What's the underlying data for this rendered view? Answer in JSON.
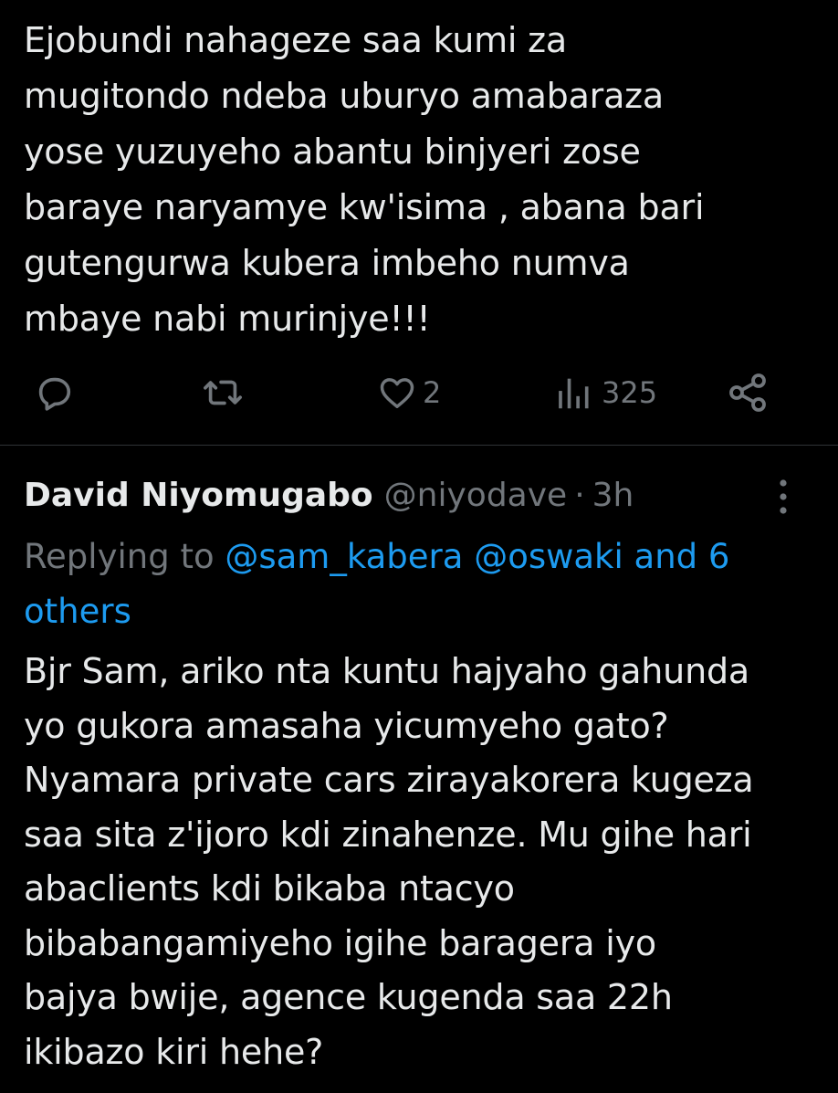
{
  "top_tweet": {
    "text_lines": [
      "Ejobundi nahageze saa kumi za",
      "mugitondo ndeba uburyo amabaraza",
      "yose yuzuyeho abantu binjyeri zose",
      "baraye naryamye kw'isima , abana bari",
      "gutengurwa kubera imbeho numva",
      "mbaye nabi murinjye!!!"
    ],
    "actions": {
      "reply_icon": "speech-bubble-icon",
      "retweet_icon": "retweet-icon",
      "like_icon": "heart-icon",
      "like_count": "2",
      "views_icon": "bar-chart-icon",
      "views_count": "325",
      "share_icon": "share-icon"
    }
  },
  "reply": {
    "author_name": "David Niyomugabo",
    "handle": "@niyodave",
    "separator": "·",
    "time": "3h",
    "more_icon": "vertical-ellipsis-icon",
    "replying_to": {
      "prefix": "Replying to ",
      "mentions_line1": "@sam_kabera @oswaki and 6",
      "mentions_line2": "others"
    },
    "text_lines": [
      "Bjr Sam, ariko nta kuntu hajyaho gahunda",
      "yo gukora amasaha yicumyeho gato?",
      "Nyamara private cars zirayakorera kugeza",
      "saa sita z'ijoro kdi zinahenze. Mu gihe hari",
      "abaclients kdi bikaba ntacyo",
      "bibabangamiyeho igihe baragera iyo",
      "bajya bwije, agence kugenda saa 22h",
      "ikibazo kiri hehe?"
    ]
  },
  "colors": {
    "background": "#000000",
    "text": "#e7e9ea",
    "muted": "#71767b",
    "link": "#1d9bf0",
    "divider": "#2f3336"
  }
}
